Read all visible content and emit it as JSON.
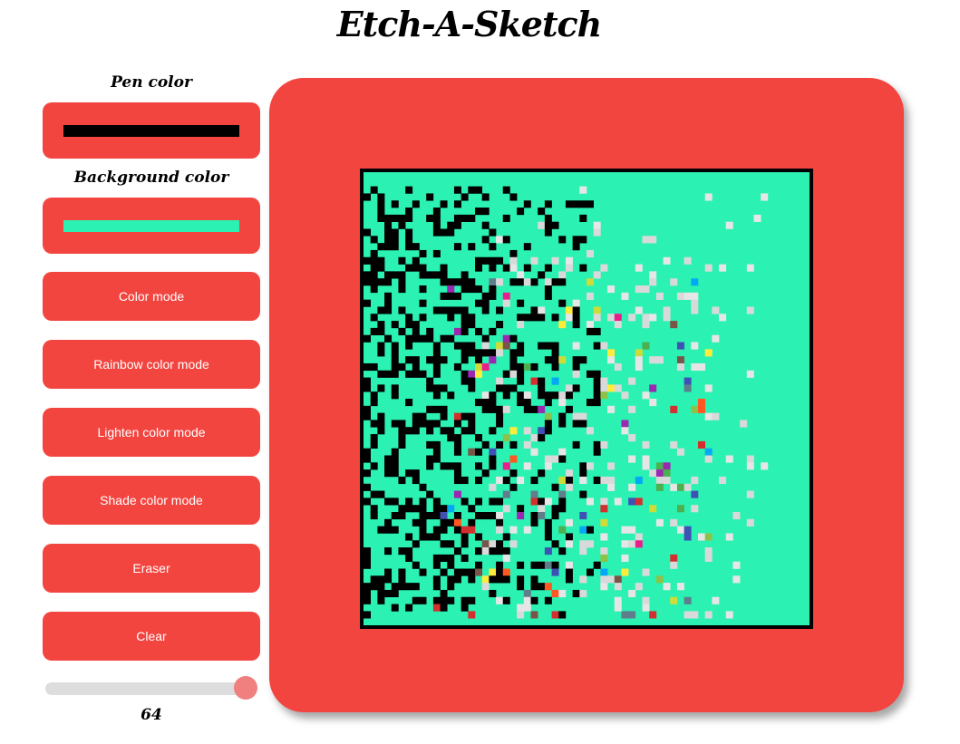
{
  "app": {
    "title": "Etch-A-Sketch"
  },
  "controls": {
    "pen_label": "Pen color",
    "pen_color": "#000000",
    "background_label": "Background color",
    "background_color": "#2bf2b2",
    "buttons": {
      "color_mode": "Color mode",
      "rainbow_mode": "Rainbow color mode",
      "lighten_mode": "Lighten color mode",
      "shade_mode": "Shade color mode",
      "eraser": "Eraser",
      "clear": "Clear"
    },
    "grid_size": {
      "value": 64,
      "min": 1,
      "max": 64,
      "label": "64"
    }
  },
  "theme": {
    "accent": "#f34540",
    "slider_thumb": "#f08080",
    "track": "#dddddd"
  }
}
